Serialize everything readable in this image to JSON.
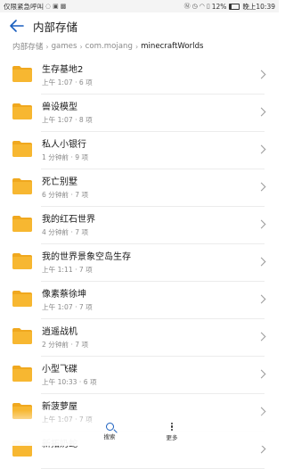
{
  "status_bar": {
    "left_text": "仅限紧急呼叫",
    "battery": "12%",
    "battery_level": 0.12,
    "time": "晚上10:39"
  },
  "header": {
    "title": "内部存储"
  },
  "breadcrumb": [
    "内部存储",
    "games",
    "com.mojang",
    "minecraftWorlds"
  ],
  "folders": [
    {
      "name": "生存基地2",
      "meta": "上午 1:07 · 6 项"
    },
    {
      "name": "兽设模型",
      "meta": "上午 1:07 · 8 项"
    },
    {
      "name": "私人小银行",
      "meta": "1 分钟前 · 9 项"
    },
    {
      "name": "死亡别墅",
      "meta": "6 分钟前 · 7 项"
    },
    {
      "name": "我的红石世界",
      "meta": "4 分钟前 · 7 项"
    },
    {
      "name": "我的世界景象空岛生存",
      "meta": "上午 1:11 · 7 项"
    },
    {
      "name": "像素蔡徐坤",
      "meta": "上午 1:07 · 7 项"
    },
    {
      "name": "逍遥战机",
      "meta": "2 分钟前 · 7 项"
    },
    {
      "name": "小型飞碟",
      "meta": "上午 10:33 · 6 项"
    },
    {
      "name": "新菠萝屋",
      "meta": "上午 1:07 · 7 项"
    },
    {
      "name": "新拓奶蛇",
      "meta": ""
    }
  ],
  "bottom_bar": {
    "search_label": "搜索",
    "more_label": "更多"
  },
  "colors": {
    "accent": "#1a5fbf",
    "folder": "#f7b731",
    "folder_tab": "#f0a81f"
  }
}
